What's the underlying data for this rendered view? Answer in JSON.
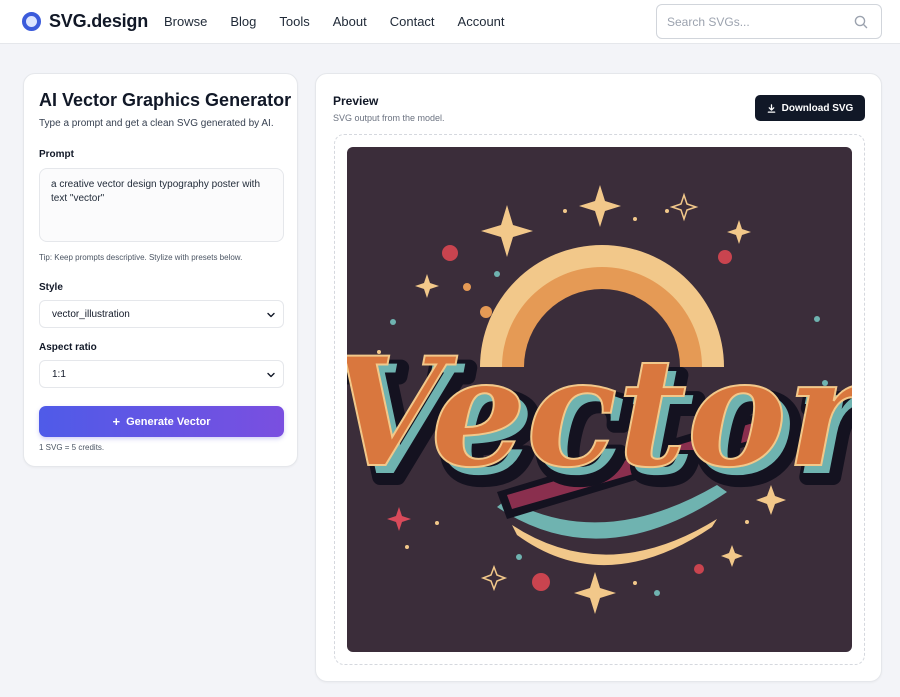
{
  "app": {
    "logo_text": "SVG.design",
    "nav": [
      "Browse",
      "Blog",
      "Tools",
      "About",
      "Contact",
      "Account"
    ],
    "search_placeholder": "Search SVGs..."
  },
  "generator": {
    "title": "AI Vector Graphics Generator",
    "subtitle": "Type a prompt and get a clean SVG generated by AI.",
    "prompt_label": "Prompt",
    "prompt_value": "a creative vector design typography poster with text \"vector\"",
    "tip": "Tip: Keep prompts descriptive. Stylize with presets below.",
    "style_label": "Style",
    "style_value": "vector_illustration",
    "aspect_label": "Aspect ratio",
    "aspect_value": "1:1",
    "generate_label": "Generate Vector",
    "credits_note": "1 SVG = 5 credits."
  },
  "preview": {
    "title": "Preview",
    "subtitle": "SVG output from the model.",
    "download_label": "Download SVG",
    "artwork_text": "Vector",
    "colors": {
      "background": "#3b2d3a",
      "orange": "#d9773e",
      "teal": "#6fb3b0",
      "cream": "#f2c88a",
      "maroon": "#8a2f4e",
      "outline": "#141220"
    }
  }
}
